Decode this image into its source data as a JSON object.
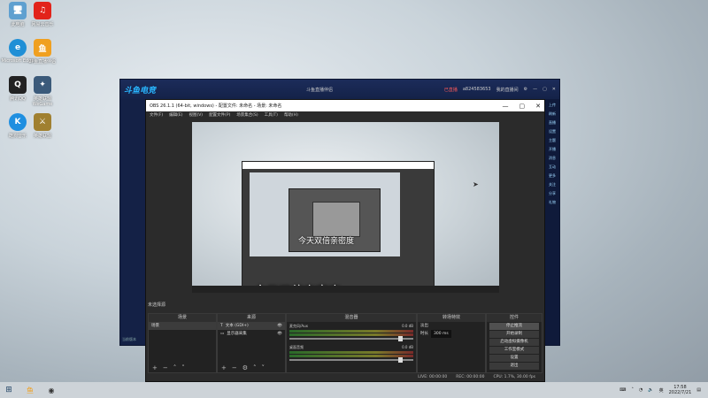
{
  "desktop": {
    "icons": [
      {
        "label": "此电脑",
        "color": "#5fa0d0",
        "glyph": "🖥"
      },
      {
        "label": "网易云音乐",
        "color": "#e2231a",
        "glyph": "♫"
      },
      {
        "label": "Microsoft Edge",
        "color": "#1f8fd6",
        "glyph": "e"
      },
      {
        "label": "斗鱼直播伴侣",
        "color": "#f0a020",
        "glyph": "鱼"
      },
      {
        "label": "腾讯QQ",
        "color": "#222222",
        "glyph": "Q"
      },
      {
        "label": "英雄联盟 WeGame",
        "color": "#3b5a7a",
        "glyph": "✦"
      },
      {
        "label": "酷狗音乐",
        "color": "#1f8fe0",
        "glyph": "K"
      },
      {
        "label": "英雄联盟",
        "color": "#a08030",
        "glyph": "⚔"
      }
    ]
  },
  "douyu": {
    "logo": "斗鱼电竞",
    "title": "斗鱼直播伴侣",
    "status_label": "已直播",
    "user_id": "a824583653",
    "user_label": "我的直播间",
    "right_texts": [
      "上传",
      "刷新",
      "直播",
      "设置",
      "主题",
      "开播",
      "消息",
      "互动",
      "更多",
      "关注",
      "分享",
      "礼物"
    ],
    "footer": "当前版本"
  },
  "obs": {
    "title": "OBS 26.1.1 (64-bit, windows) - 配置文件: 未命名 - 场景: 未命名",
    "menu": [
      "文件(F)",
      "编辑(E)",
      "视图(V)",
      "配置文件(P)",
      "场景集合(S)",
      "工具(T)",
      "帮助(H)"
    ],
    "preview_subtitle_small": "今天双倍亲密度",
    "preview_subtitle_large": "今天双倍亲密度",
    "scene_filter_label": "未选择源",
    "docks": {
      "scenes": {
        "title": "场景",
        "items": [
          "场景"
        ]
      },
      "sources": {
        "title": "来源",
        "items": [
          {
            "label": "文本 (GDI+)",
            "icon": "T"
          },
          {
            "label": "显示器采集",
            "icon": "▭"
          }
        ]
      },
      "mixer": {
        "title": "混音器",
        "tracks": [
          {
            "name": "麦克风/Aux",
            "db": "0.0 dB"
          },
          {
            "name": "桌面音频",
            "db": "0.0 dB"
          }
        ]
      },
      "transitions": {
        "title": "转场特效",
        "type": "淡出",
        "duration_label": "时长",
        "duration_value": "300 ms"
      },
      "controls": {
        "title": "控件",
        "buttons": [
          "停止推流",
          "开始录制",
          "启动虚拟摄像机",
          "工作室模式",
          "设置",
          "退出"
        ]
      }
    },
    "status": {
      "live": "LIVE: 00:00:00",
      "rec": "REC: 00:00:00",
      "cpu": "CPU: 1.7%, 30.00 fps"
    }
  },
  "taskbar": {
    "time": "17:58",
    "date": "2022/7/21",
    "lang": "英"
  }
}
